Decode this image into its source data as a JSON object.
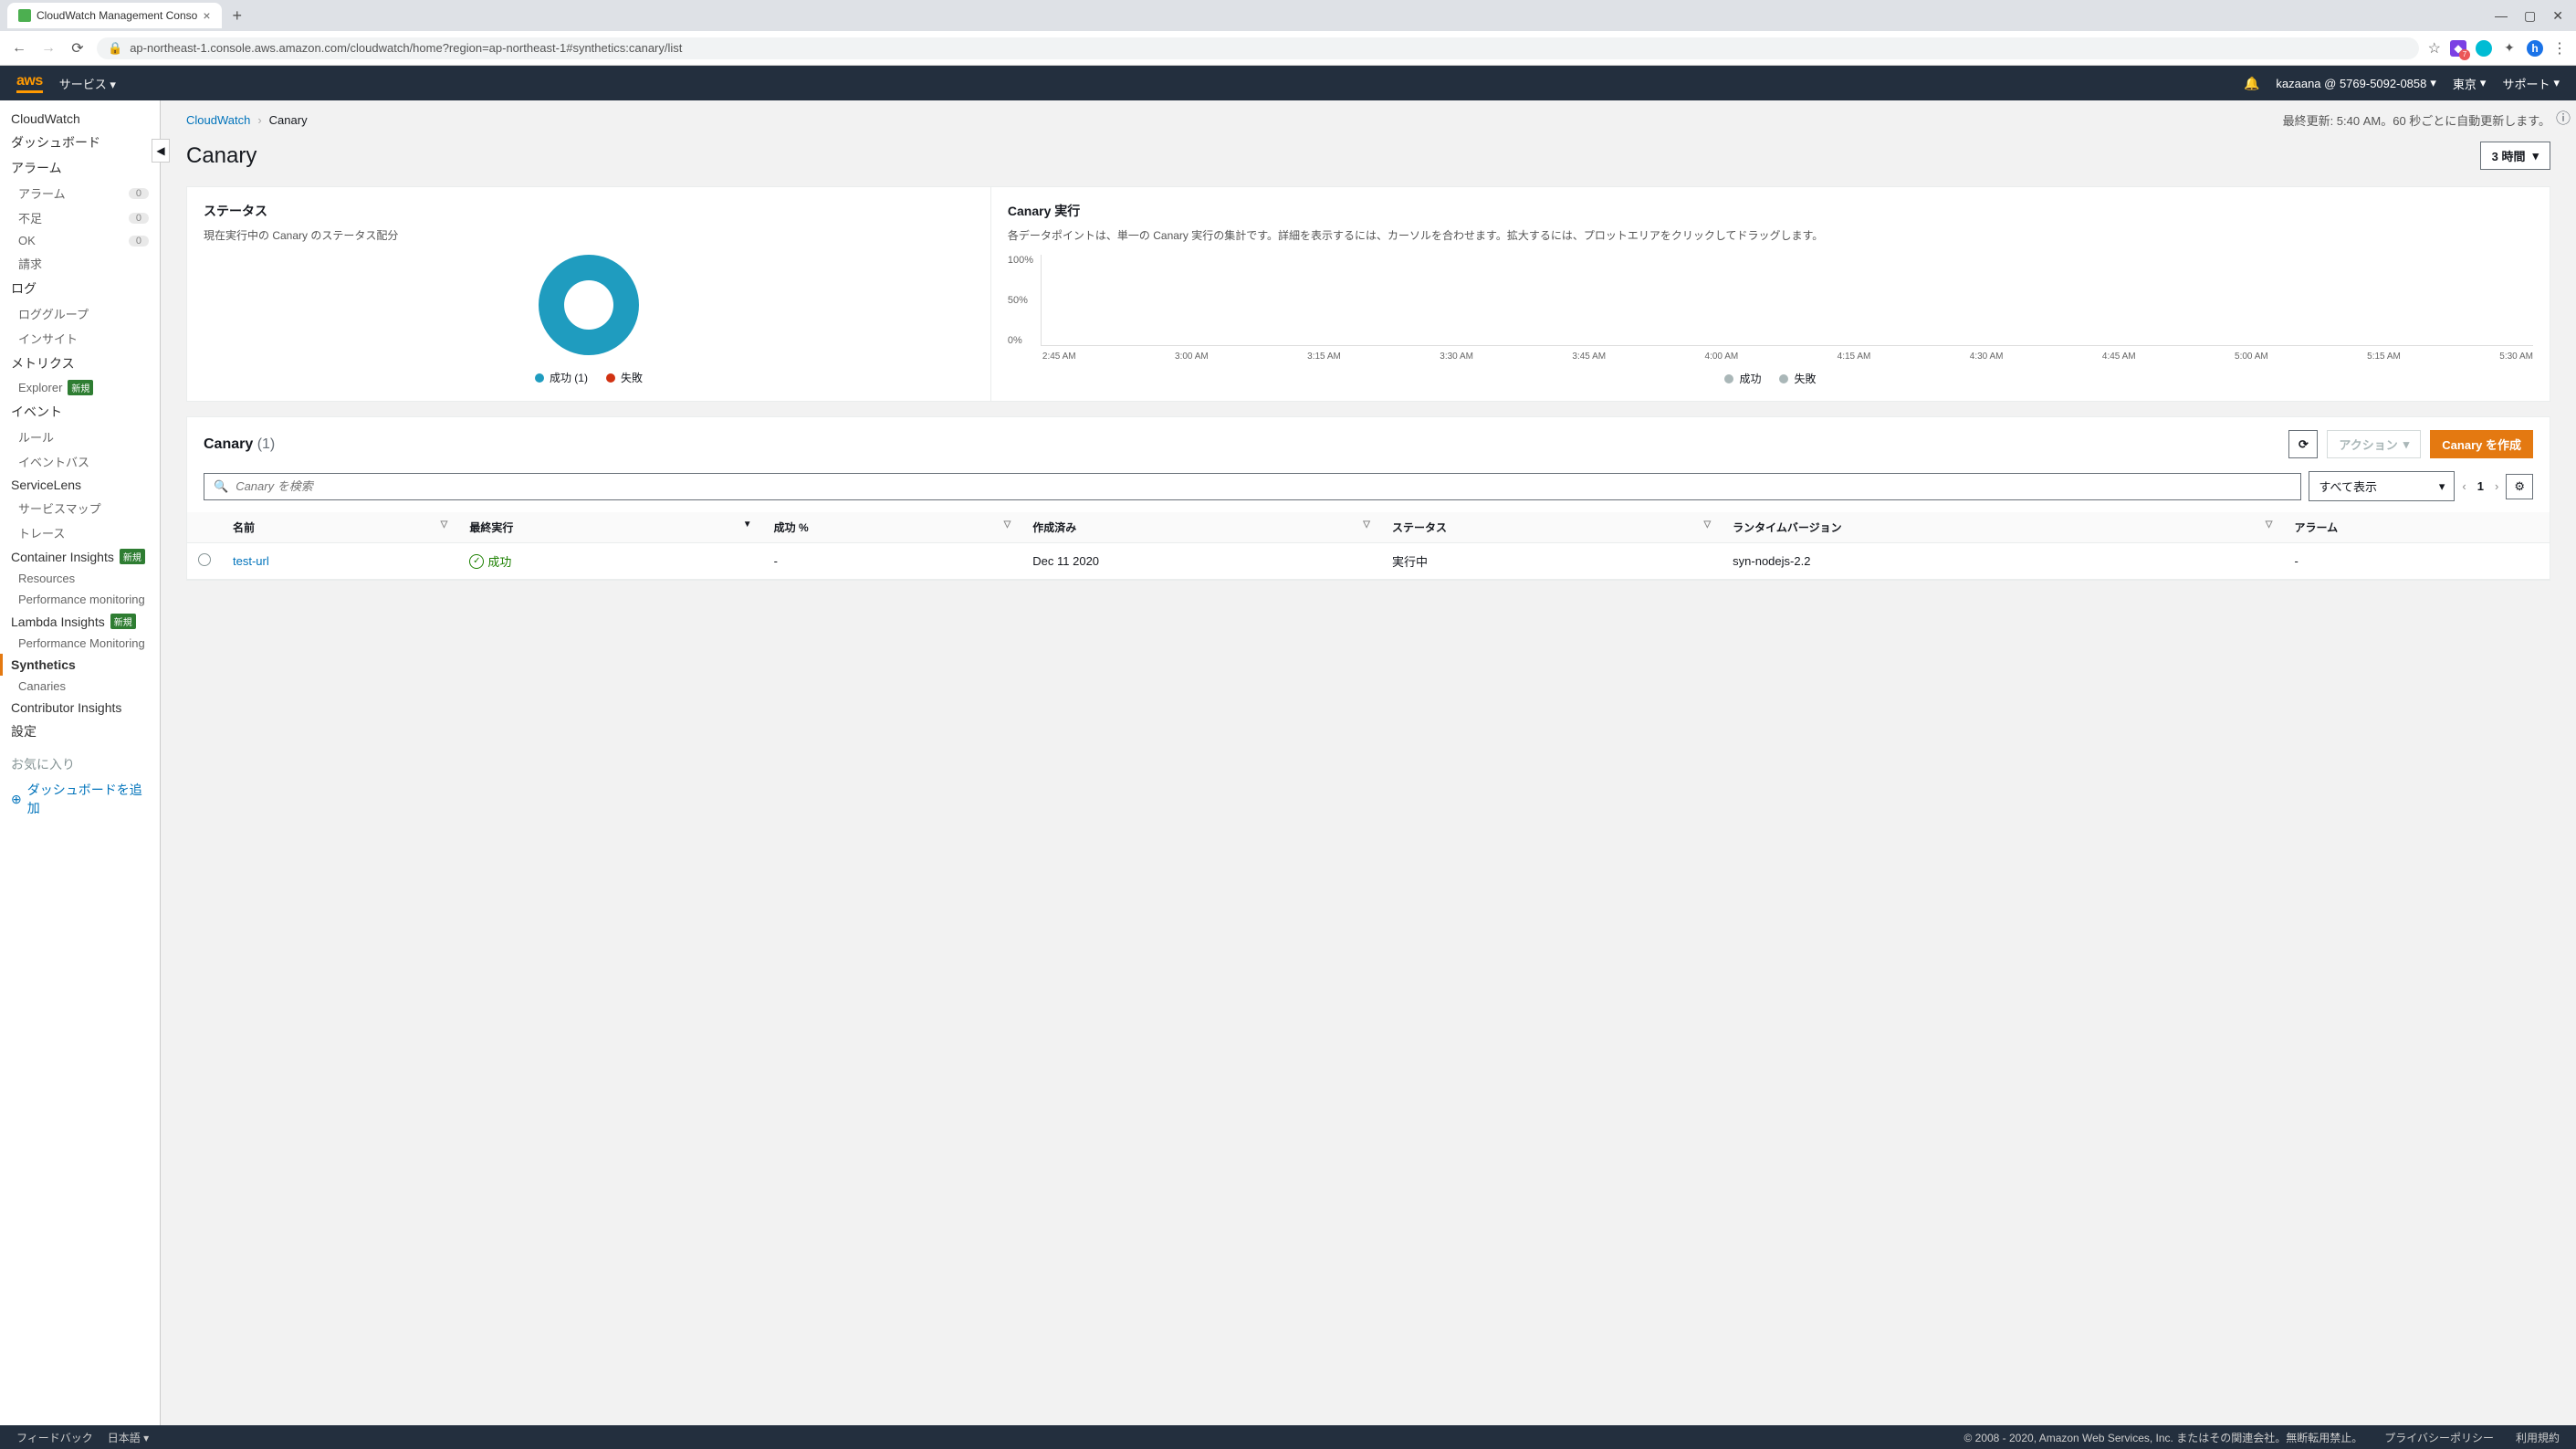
{
  "browser": {
    "tab_title": "CloudWatch Management Conso",
    "url": "ap-northeast-1.console.aws.amazon.com/cloudwatch/home?region=ap-northeast-1#synthetics:canary/list"
  },
  "aws_nav": {
    "logo": "aws",
    "services": "サービス",
    "account": "kazaana @ 5769-5092-0858",
    "region": "東京",
    "support": "サポート"
  },
  "sidebar": {
    "service": "CloudWatch",
    "dashboard": "ダッシュボード",
    "alarm": "アラーム",
    "alarm_sub": {
      "alarm": "アラーム",
      "insufficient": "不足",
      "ok": "OK",
      "billing": "請求"
    },
    "log": "ログ",
    "log_sub": {
      "groups": "ロググループ",
      "insights": "インサイト"
    },
    "metrics": "メトリクス",
    "metrics_sub": {
      "explorer": "Explorer",
      "new_badge": "新規"
    },
    "events": "イベント",
    "events_sub": {
      "rules": "ルール",
      "eventbus": "イベントバス"
    },
    "servicelens": "ServiceLens",
    "servicelens_sub": {
      "map": "サービスマップ",
      "traces": "トレース"
    },
    "container": "Container Insights",
    "container_sub": {
      "resources": "Resources",
      "perf": "Performance monitoring"
    },
    "lambda": "Lambda Insights",
    "lambda_sub": {
      "perf": "Performance Monitoring"
    },
    "synthetics": "Synthetics",
    "synthetics_sub": {
      "canaries": "Canaries"
    },
    "contributor": "Contributor Insights",
    "settings": "設定",
    "favorites": "お気に入り",
    "add_dashboard": "ダッシュボードを追加",
    "zero": "0"
  },
  "breadcrumb": {
    "root": "CloudWatch",
    "current": "Canary"
  },
  "last_update": "最終更新: 5:40 AM。60 秒ごとに自動更新します。",
  "page_title": "Canary",
  "time_range": "3 時間",
  "status_panel": {
    "title": "ステータス",
    "desc": "現在実行中の Canary のステータス配分",
    "legend_success": "成功 (1)",
    "legend_fail": "失敗"
  },
  "exec_panel": {
    "title": "Canary 実行",
    "desc": "各データポイントは、単一の Canary 実行の集計です。詳細を表示するには、カーソルを合わせます。拡大するには、プロットエリアをクリックしてドラッグします。",
    "legend_success": "成功",
    "legend_fail": "失敗",
    "y_100": "100%",
    "y_50": "50%",
    "y_0": "0%",
    "x_ticks": [
      "2:45 AM",
      "3:00 AM",
      "3:15 AM",
      "3:30 AM",
      "3:45 AM",
      "4:00 AM",
      "4:15 AM",
      "4:30 AM",
      "4:45 AM",
      "5:00 AM",
      "5:15 AM",
      "5:30 AM"
    ]
  },
  "canary_list": {
    "title": "Canary",
    "count": "(1)",
    "action_label": "アクション",
    "create_label": "Canary を作成",
    "search_placeholder": "Canary を検索",
    "filter_all": "すべて表示",
    "page": "1",
    "cols": {
      "name": "名前",
      "last_run": "最終実行",
      "success_pct": "成功 %",
      "created": "作成済み",
      "status": "ステータス",
      "runtime": "ランタイムバージョン",
      "alarm": "アラーム"
    },
    "rows": [
      {
        "name": "test-url",
        "last_run": "成功",
        "success_pct": "-",
        "created": "Dec 11 2020",
        "status": "実行中",
        "runtime": "syn-nodejs-2.2",
        "alarm": "-"
      }
    ]
  },
  "footer": {
    "feedback": "フィードバック",
    "lang": "日本語",
    "copyright": "© 2008 - 2020, Amazon Web Services, Inc. またはその関連会社。無断転用禁止。",
    "privacy": "プライバシーポリシー",
    "terms": "利用規約"
  },
  "chart_data": [
    {
      "type": "pie",
      "title": "ステータス",
      "series": [
        {
          "name": "成功",
          "value": 1,
          "color": "#1f9cbf"
        },
        {
          "name": "失敗",
          "value": 0,
          "color": "#d13212"
        }
      ]
    },
    {
      "type": "line",
      "title": "Canary 実行",
      "ylabel": "%",
      "ylim": [
        0,
        100
      ],
      "x": [
        "2:45 AM",
        "3:00 AM",
        "3:15 AM",
        "3:30 AM",
        "3:45 AM",
        "4:00 AM",
        "4:15 AM",
        "4:30 AM",
        "4:45 AM",
        "5:00 AM",
        "5:15 AM",
        "5:30 AM"
      ],
      "series": [
        {
          "name": "成功",
          "values": [
            null,
            null,
            null,
            null,
            null,
            null,
            null,
            null,
            null,
            null,
            null,
            null
          ]
        },
        {
          "name": "失敗",
          "values": [
            null,
            null,
            null,
            null,
            null,
            null,
            null,
            null,
            null,
            null,
            null,
            null
          ]
        }
      ]
    }
  ]
}
